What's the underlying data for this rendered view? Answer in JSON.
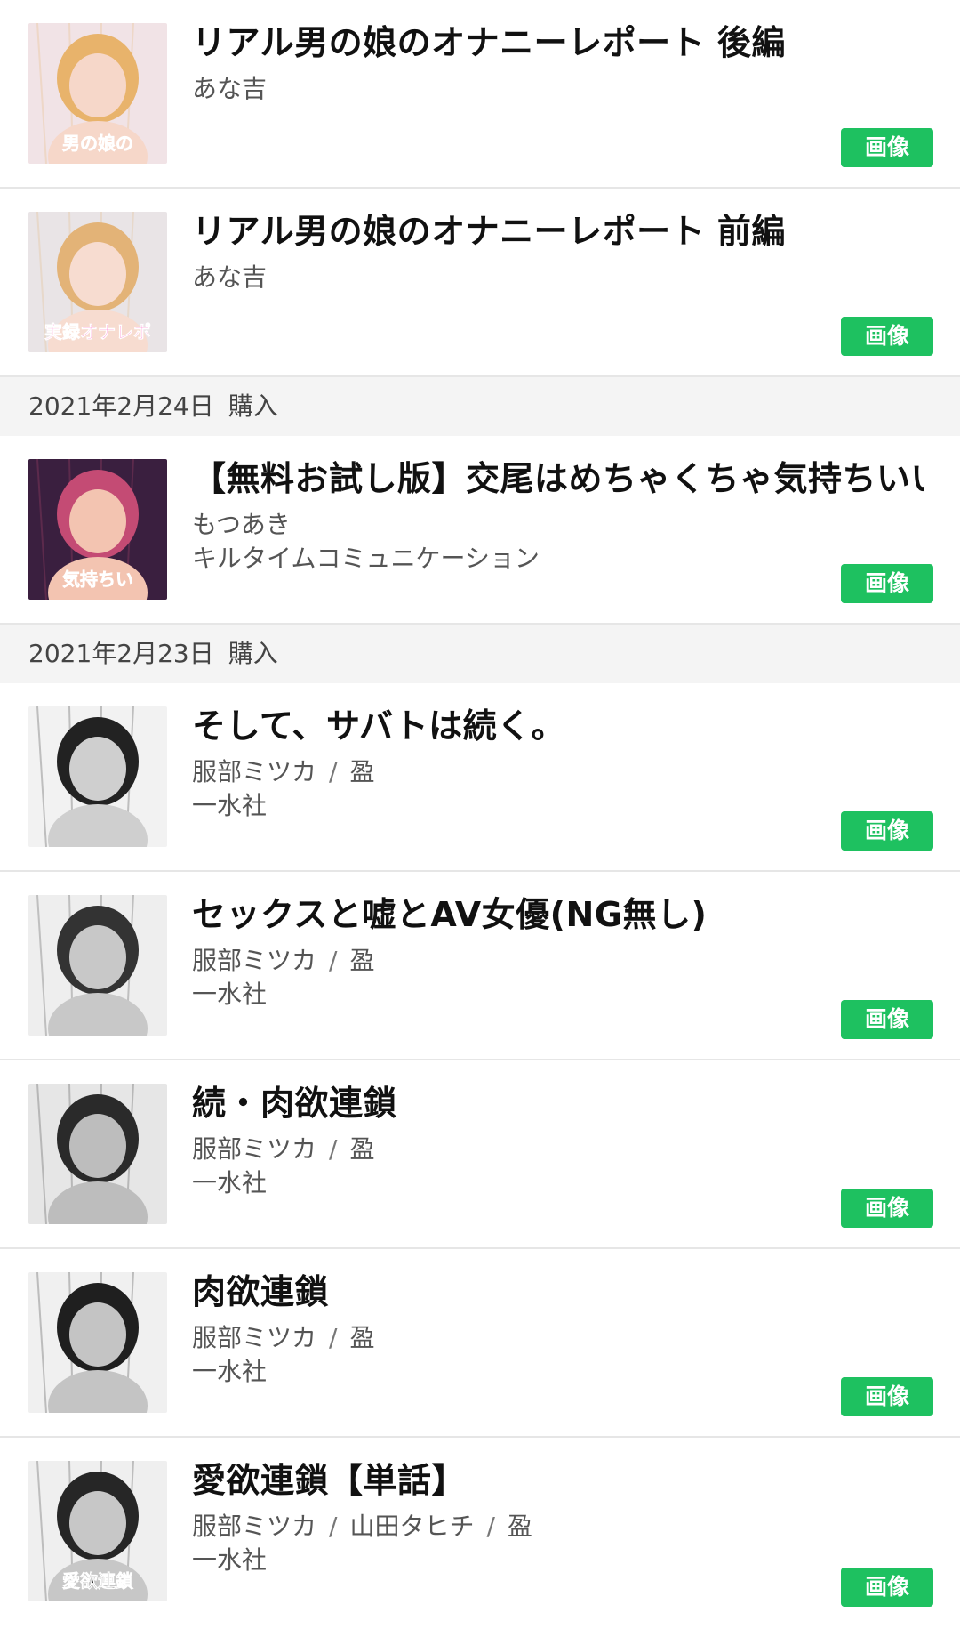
{
  "badge_label": "画像",
  "purchase_label": "購入",
  "author_separator": "/",
  "sections": [
    {
      "date": "",
      "items": [
        {
          "title": "リアル男の娘のオナニーレポート 後編",
          "authors": [
            "あな吉"
          ],
          "publisher": "",
          "thumb": {
            "bg": "#f1e3e6",
            "accent": "#e8b36b",
            "skin": "#f6d7c9",
            "caption": "男の娘の",
            "caption_color": "#ffffff"
          }
        },
        {
          "title": "リアル男の娘のオナニーレポート 前編",
          "authors": [
            "あな吉"
          ],
          "publisher": "",
          "thumb": {
            "bg": "#e9e4e6",
            "accent": "#e3b377",
            "skin": "#f7dcd0",
            "caption": "実録オナレポ",
            "caption_color": "#ff5fbf"
          }
        }
      ]
    },
    {
      "date": "2021年2月24日",
      "items": [
        {
          "title": "【無料お試し版】交尾はめちゃくちゃ気持ちいい",
          "authors": [
            "もつあき"
          ],
          "publisher": "キルタイムコミュニケーション",
          "thumb": {
            "bg": "#3a1f3f",
            "accent": "#c44b74",
            "skin": "#f3c4b1",
            "caption": "気持ちい",
            "caption_color": "#ffffff"
          }
        }
      ]
    },
    {
      "date": "2021年2月23日",
      "items": [
        {
          "title": "そして、サバトは続く。",
          "authors": [
            "服部ミツカ",
            "盈"
          ],
          "publisher": "一水社",
          "thumb": {
            "bg": "#f2f2f2",
            "accent": "#222222",
            "skin": "#cfcfcf",
            "caption": "",
            "caption_color": "#000000"
          }
        },
        {
          "title": "セックスと嘘とAV女優(NG無し)",
          "authors": [
            "服部ミツカ",
            "盈"
          ],
          "publisher": "一水社",
          "thumb": {
            "bg": "#eeeeee",
            "accent": "#333333",
            "skin": "#c8c8c8",
            "caption": "",
            "caption_color": "#000000"
          }
        },
        {
          "title": "続・肉欲連鎖",
          "authors": [
            "服部ミツカ",
            "盈"
          ],
          "publisher": "一水社",
          "thumb": {
            "bg": "#e6e6e6",
            "accent": "#2a2a2a",
            "skin": "#bdbdbd",
            "caption": "",
            "caption_color": "#000000"
          }
        },
        {
          "title": "肉欲連鎖",
          "authors": [
            "服部ミツカ",
            "盈"
          ],
          "publisher": "一水社",
          "thumb": {
            "bg": "#f0f0f0",
            "accent": "#1f1f1f",
            "skin": "#c4c4c4",
            "caption": "",
            "caption_color": "#000000"
          }
        },
        {
          "title": "愛欲連鎖【単話】",
          "authors": [
            "服部ミツカ",
            "山田タヒチ",
            "盈"
          ],
          "publisher": "一水社",
          "thumb": {
            "bg": "#efefef",
            "accent": "#262626",
            "skin": "#c7c7c7",
            "caption": "愛欲連鎖",
            "caption_color": "#111111"
          }
        }
      ]
    }
  ]
}
